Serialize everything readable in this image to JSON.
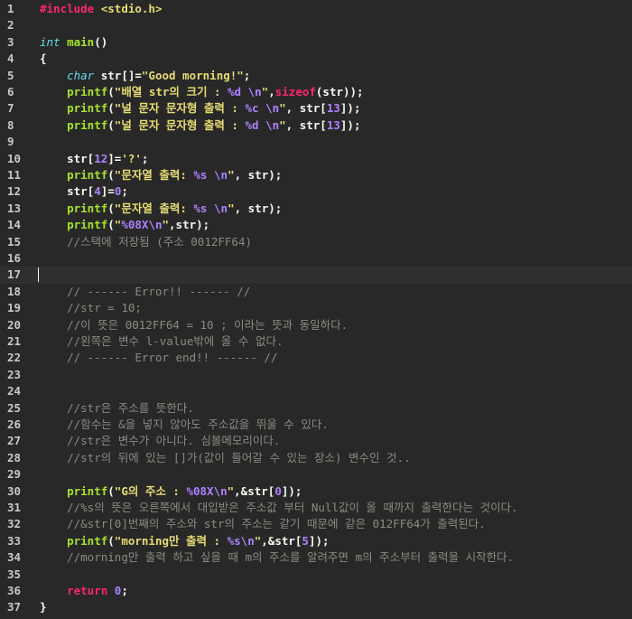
{
  "editor": {
    "theme_colors": {
      "background": "#282828",
      "keyword": "#f92672",
      "type": "#66d9ef",
      "function": "#a6e22e",
      "string": "#e6db74",
      "number": "#ae81ff",
      "comment": "#8a8a80",
      "text": "#f8f8f2"
    },
    "current_line": 17,
    "lines": [
      {
        "n": "1",
        "tokens": [
          {
            "t": "#include",
            "c": "pp"
          },
          {
            "t": " <stdio.h>",
            "c": "inc"
          }
        ]
      },
      {
        "n": "2",
        "tokens": []
      },
      {
        "n": "3",
        "tokens": [
          {
            "t": "int",
            "c": "type"
          },
          {
            "t": " main",
            "c": "fn"
          },
          {
            "t": "()",
            "c": "punc"
          }
        ]
      },
      {
        "n": "4",
        "tokens": [
          {
            "t": "{",
            "c": "punc"
          }
        ]
      },
      {
        "n": "5",
        "tokens": [
          {
            "t": "    ",
            "c": "plain"
          },
          {
            "t": "char",
            "c": "type"
          },
          {
            "t": " str[]=",
            "c": "plain"
          },
          {
            "t": "\"Good morning!\"",
            "c": "str"
          },
          {
            "t": ";",
            "c": "plain"
          }
        ]
      },
      {
        "n": "6",
        "tokens": [
          {
            "t": "    ",
            "c": "plain"
          },
          {
            "t": "printf",
            "c": "fn"
          },
          {
            "t": "(",
            "c": "plain"
          },
          {
            "t": "\"배열 str의 크기 : ",
            "c": "str"
          },
          {
            "t": "%d",
            "c": "fmt"
          },
          {
            "t": " ",
            "c": "str"
          },
          {
            "t": "\\n",
            "c": "fmt"
          },
          {
            "t": "\"",
            "c": "str"
          },
          {
            "t": ",",
            "c": "plain"
          },
          {
            "t": "sizeof",
            "c": "kw"
          },
          {
            "t": "(str));",
            "c": "plain"
          }
        ]
      },
      {
        "n": "7",
        "tokens": [
          {
            "t": "    ",
            "c": "plain"
          },
          {
            "t": "printf",
            "c": "fn"
          },
          {
            "t": "(",
            "c": "plain"
          },
          {
            "t": "\"널 문자 문자형 출력 : ",
            "c": "str"
          },
          {
            "t": "%c",
            "c": "fmt"
          },
          {
            "t": " ",
            "c": "str"
          },
          {
            "t": "\\n",
            "c": "fmt"
          },
          {
            "t": "\"",
            "c": "str"
          },
          {
            "t": ", str[",
            "c": "plain"
          },
          {
            "t": "13",
            "c": "num"
          },
          {
            "t": "]);",
            "c": "plain"
          }
        ]
      },
      {
        "n": "8",
        "tokens": [
          {
            "t": "    ",
            "c": "plain"
          },
          {
            "t": "printf",
            "c": "fn"
          },
          {
            "t": "(",
            "c": "plain"
          },
          {
            "t": "\"널 문자 문자형 출력 : ",
            "c": "str"
          },
          {
            "t": "%d",
            "c": "fmt"
          },
          {
            "t": " ",
            "c": "str"
          },
          {
            "t": "\\n",
            "c": "fmt"
          },
          {
            "t": "\"",
            "c": "str"
          },
          {
            "t": ", str[",
            "c": "plain"
          },
          {
            "t": "13",
            "c": "num"
          },
          {
            "t": "]);",
            "c": "plain"
          }
        ]
      },
      {
        "n": "9",
        "tokens": []
      },
      {
        "n": "10",
        "tokens": [
          {
            "t": "    ",
            "c": "plain"
          },
          {
            "t": "str[",
            "c": "plain"
          },
          {
            "t": "12",
            "c": "num"
          },
          {
            "t": "]=",
            "c": "plain"
          },
          {
            "t": "'?'",
            "c": "str"
          },
          {
            "t": ";",
            "c": "plain"
          }
        ]
      },
      {
        "n": "11",
        "tokens": [
          {
            "t": "    ",
            "c": "plain"
          },
          {
            "t": "printf",
            "c": "fn"
          },
          {
            "t": "(",
            "c": "plain"
          },
          {
            "t": "\"문자열 출력: ",
            "c": "str"
          },
          {
            "t": "%s",
            "c": "fmt"
          },
          {
            "t": " ",
            "c": "str"
          },
          {
            "t": "\\n",
            "c": "fmt"
          },
          {
            "t": "\"",
            "c": "str"
          },
          {
            "t": ", str);",
            "c": "plain"
          }
        ]
      },
      {
        "n": "12",
        "tokens": [
          {
            "t": "    ",
            "c": "plain"
          },
          {
            "t": "str[",
            "c": "plain"
          },
          {
            "t": "4",
            "c": "num"
          },
          {
            "t": "]=",
            "c": "plain"
          },
          {
            "t": "0",
            "c": "num"
          },
          {
            "t": ";",
            "c": "plain"
          }
        ]
      },
      {
        "n": "13",
        "tokens": [
          {
            "t": "    ",
            "c": "plain"
          },
          {
            "t": "printf",
            "c": "fn"
          },
          {
            "t": "(",
            "c": "plain"
          },
          {
            "t": "\"문자열 출력: ",
            "c": "str"
          },
          {
            "t": "%s",
            "c": "fmt"
          },
          {
            "t": " ",
            "c": "str"
          },
          {
            "t": "\\n",
            "c": "fmt"
          },
          {
            "t": "\"",
            "c": "str"
          },
          {
            "t": ", str);",
            "c": "plain"
          }
        ]
      },
      {
        "n": "14",
        "tokens": [
          {
            "t": "    ",
            "c": "plain"
          },
          {
            "t": "printf",
            "c": "fn"
          },
          {
            "t": "(",
            "c": "plain"
          },
          {
            "t": "\"",
            "c": "str"
          },
          {
            "t": "%08X",
            "c": "fmt"
          },
          {
            "t": "\\n",
            "c": "fmt"
          },
          {
            "t": "\"",
            "c": "str"
          },
          {
            "t": ",str);",
            "c": "plain"
          }
        ]
      },
      {
        "n": "15",
        "tokens": [
          {
            "t": "    ",
            "c": "plain"
          },
          {
            "t": "//스택에 저장됨 (주소 0012FF64)",
            "c": "cmt"
          }
        ]
      },
      {
        "n": "16",
        "tokens": []
      },
      {
        "n": "17",
        "tokens": []
      },
      {
        "n": "18",
        "tokens": [
          {
            "t": "    ",
            "c": "plain"
          },
          {
            "t": "// ------ Error!! ------ //",
            "c": "cmt"
          }
        ]
      },
      {
        "n": "19",
        "tokens": [
          {
            "t": "    ",
            "c": "plain"
          },
          {
            "t": "//str = 10;",
            "c": "cmt"
          }
        ]
      },
      {
        "n": "20",
        "tokens": [
          {
            "t": "    ",
            "c": "plain"
          },
          {
            "t": "//이 뜻은 0012FF64 = 10 ; 이라는 뜻과 동일하다.",
            "c": "cmt"
          }
        ]
      },
      {
        "n": "21",
        "tokens": [
          {
            "t": "    ",
            "c": "plain"
          },
          {
            "t": "//왼쪽은 변수 l-value밖에 올 수 없다.",
            "c": "cmt"
          }
        ]
      },
      {
        "n": "22",
        "tokens": [
          {
            "t": "    ",
            "c": "plain"
          },
          {
            "t": "// ------ Error end!! ------ //",
            "c": "cmt"
          }
        ]
      },
      {
        "n": "23",
        "tokens": []
      },
      {
        "n": "24",
        "tokens": []
      },
      {
        "n": "25",
        "tokens": [
          {
            "t": "    ",
            "c": "plain"
          },
          {
            "t": "//str은 주소를 뜻한다.",
            "c": "cmt"
          }
        ]
      },
      {
        "n": "26",
        "tokens": [
          {
            "t": "    ",
            "c": "plain"
          },
          {
            "t": "//함수는 &을 넣지 않아도 주소값을 뛰울 수 있다.",
            "c": "cmt"
          }
        ]
      },
      {
        "n": "27",
        "tokens": [
          {
            "t": "    ",
            "c": "plain"
          },
          {
            "t": "//str은 변수가 아니다. 심볼메모리이다.",
            "c": "cmt"
          }
        ]
      },
      {
        "n": "28",
        "tokens": [
          {
            "t": "    ",
            "c": "plain"
          },
          {
            "t": "//str의 뒤에 있는 []가(값이 들어갈 수 있는 장소) 변수인 것..",
            "c": "cmt"
          }
        ]
      },
      {
        "n": "29",
        "tokens": []
      },
      {
        "n": "30",
        "tokens": [
          {
            "t": "    ",
            "c": "plain"
          },
          {
            "t": "printf",
            "c": "fn"
          },
          {
            "t": "(",
            "c": "plain"
          },
          {
            "t": "\"G의 주소 : ",
            "c": "str"
          },
          {
            "t": "%08X",
            "c": "fmt"
          },
          {
            "t": "\\n",
            "c": "fmt"
          },
          {
            "t": "\"",
            "c": "str"
          },
          {
            "t": ",&str[",
            "c": "plain"
          },
          {
            "t": "0",
            "c": "num"
          },
          {
            "t": "]);",
            "c": "plain"
          }
        ]
      },
      {
        "n": "31",
        "tokens": [
          {
            "t": "    ",
            "c": "plain"
          },
          {
            "t": "//%s의 뜻은 오른쪽에서 대입받은 주소값 부터 Null값이 올 때까지 출력한다는 것이다.",
            "c": "cmt"
          }
        ]
      },
      {
        "n": "32",
        "tokens": [
          {
            "t": "    ",
            "c": "plain"
          },
          {
            "t": "//&str[0]번째의 주소와 str의 주소는 같기 때문에 같은 012FF64가 출력된다.",
            "c": "cmt"
          }
        ]
      },
      {
        "n": "33",
        "tokens": [
          {
            "t": "    ",
            "c": "plain"
          },
          {
            "t": "printf",
            "c": "fn"
          },
          {
            "t": "(",
            "c": "plain"
          },
          {
            "t": "\"morning만 출력 : ",
            "c": "str"
          },
          {
            "t": "%s",
            "c": "fmt"
          },
          {
            "t": "\\n",
            "c": "fmt"
          },
          {
            "t": "\"",
            "c": "str"
          },
          {
            "t": ",&str[",
            "c": "plain"
          },
          {
            "t": "5",
            "c": "num"
          },
          {
            "t": "]);",
            "c": "plain"
          }
        ]
      },
      {
        "n": "34",
        "tokens": [
          {
            "t": "    ",
            "c": "plain"
          },
          {
            "t": "//morning만 출력 하고 싶을 때 m의 주소를 알려주면 m의 주소부터 출력을 시작한다.",
            "c": "cmt"
          }
        ]
      },
      {
        "n": "35",
        "tokens": []
      },
      {
        "n": "36",
        "tokens": [
          {
            "t": "    ",
            "c": "plain"
          },
          {
            "t": "return",
            "c": "kw"
          },
          {
            "t": " ",
            "c": "plain"
          },
          {
            "t": "0",
            "c": "num"
          },
          {
            "t": ";",
            "c": "plain"
          }
        ]
      },
      {
        "n": "37",
        "tokens": [
          {
            "t": "}",
            "c": "punc"
          }
        ]
      }
    ]
  }
}
